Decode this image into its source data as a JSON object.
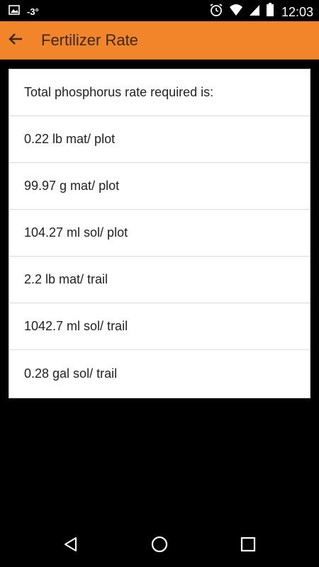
{
  "status_bar": {
    "temperature": "-3°",
    "time": "12:03",
    "icons": [
      "image-icon",
      "alarm-icon",
      "wifi-icon",
      "signal-icon",
      "battery-icon"
    ]
  },
  "app_bar": {
    "title": "Fertilizer Rate",
    "background": "#f2852a",
    "back_icon": "back-arrow-icon"
  },
  "results": {
    "heading": "Total phosphorus rate required is:",
    "items": [
      "0.22 lb mat/ plot",
      "99.97 g mat/ plot",
      "104.27 ml sol/ plot",
      "2.2 lb mat/ trail",
      "1042.7 ml sol/ trail",
      "0.28 gal sol/ trail"
    ]
  },
  "nav_bar": {
    "icons": [
      "back-triangle-icon",
      "home-circle-icon",
      "recents-square-icon"
    ]
  }
}
